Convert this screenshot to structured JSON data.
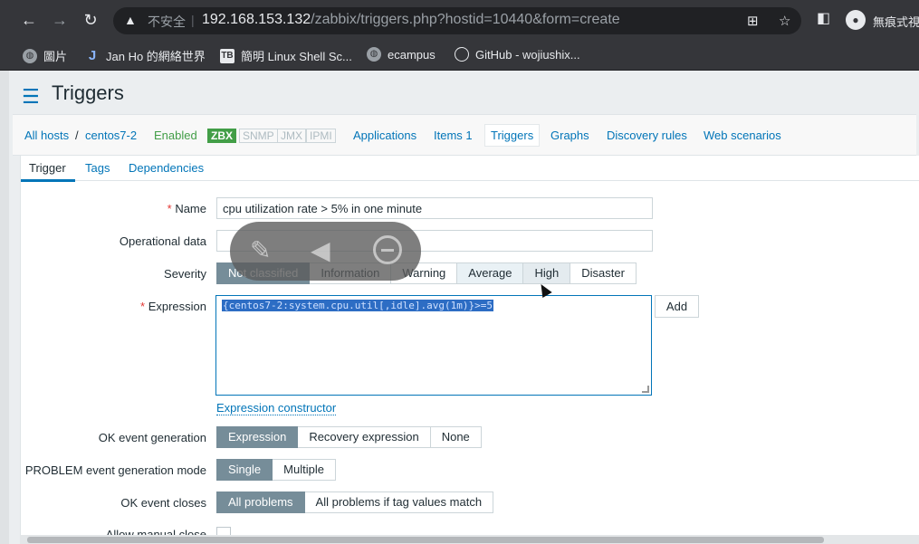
{
  "browser": {
    "insecure_label": "不安全",
    "url_host": "192.168.153.132",
    "url_path": "/zabbix/triggers.php?hostid=10440&form=create",
    "profile_name": "無痕式視",
    "bookmarks": [
      {
        "icon": "globe-icon",
        "label": "圖片"
      },
      {
        "icon": "J",
        "label": "Jan Ho 的網絡世界"
      },
      {
        "icon": "TB",
        "label": "簡明 Linux Shell Sc..."
      },
      {
        "icon": "globe-icon",
        "label": "ecampus"
      },
      {
        "icon": "github-icon",
        "label": "GitHub - wojiushix..."
      }
    ]
  },
  "page": {
    "title": "Triggers"
  },
  "host_nav": {
    "all_hosts": "All hosts",
    "separator": "/",
    "host": "centos7-2",
    "status": "Enabled",
    "protocols": [
      "ZBX",
      "SNMP",
      "JMX",
      "IPMI"
    ],
    "links": [
      "Applications",
      "Items 1",
      "Triggers",
      "Graphs",
      "Discovery rules",
      "Web scenarios"
    ]
  },
  "tabs": [
    "Trigger",
    "Tags",
    "Dependencies"
  ],
  "form": {
    "required_mark": "*",
    "name_label": "Name",
    "name_value": "cpu utilization rate > 5% in one minute",
    "opdata_label": "Operational data",
    "opdata_value": "",
    "severity_label": "Severity",
    "severity_options": [
      "Not classified",
      "Information",
      "Warning",
      "Average",
      "High",
      "Disaster"
    ],
    "severity_selected": "Not classified",
    "expression_label": "Expression",
    "expression_value": "{centos7-2:system.cpu.util[,idle].avg(1m)}>=5",
    "add_label": "Add",
    "expression_constructor": "Expression constructor",
    "ok_gen_label": "OK event generation",
    "ok_gen_options": [
      "Expression",
      "Recovery expression",
      "None"
    ],
    "problem_mode_label": "PROBLEM event generation mode",
    "problem_mode_options": [
      "Single",
      "Multiple"
    ],
    "ok_closes_label": "OK event closes",
    "ok_closes_options": [
      "All problems",
      "All problems if tag values match"
    ],
    "manual_close_label": "Allow manual close"
  },
  "colors": {
    "accent": "#0275b8",
    "selected_segment": "#768d99",
    "enabled": "#429e47",
    "required": "#e33734"
  }
}
